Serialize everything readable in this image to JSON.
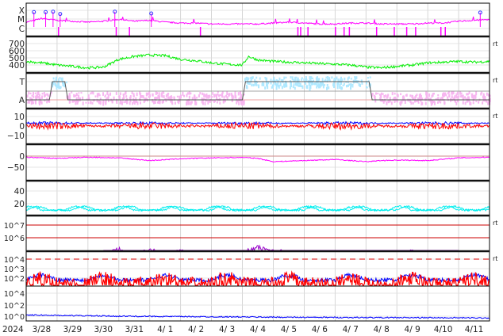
{
  "chart_data": {
    "type": "line",
    "title": "",
    "year_label": "2024",
    "x_tick_labels": [
      "3/28",
      "3/29",
      "3/30",
      "3/31",
      "4/ 1",
      "4/ 2",
      "4/ 3",
      "4/ 4",
      "4/ 5",
      "4/ 6",
      "4/ 7",
      "4/ 8",
      "4/ 9",
      "4/10",
      "4/11"
    ],
    "x_range_days": [
      0,
      15
    ],
    "realtime_marker": "rt",
    "panels": [
      {
        "name": "xray-flux",
        "tick_labels": [
          "X",
          "M",
          "C"
        ],
        "ylim_class": [
          1.5,
          4.5
        ],
        "series": [
          {
            "name": "xray",
            "color": "#ff00ff",
            "x": [
              0,
              0.5,
              1,
              1.5,
              2,
              2.5,
              3,
              3.5,
              4,
              4.5,
              5,
              5.5,
              6,
              6.5,
              7,
              7.5,
              8,
              8.5,
              9,
              9.5,
              10,
              10.5,
              11,
              11.5,
              12,
              12.5,
              13,
              13.5,
              14,
              14.5,
              15
            ],
            "y": [
              2.7,
              3.1,
              2.9,
              2.8,
              2.7,
              2.8,
              3.0,
              2.8,
              2.9,
              2.7,
              2.6,
              2.6,
              2.5,
              2.5,
              2.5,
              2.5,
              2.6,
              2.7,
              2.6,
              2.5,
              2.5,
              2.6,
              2.6,
              2.5,
              2.5,
              2.5,
              2.6,
              2.6,
              2.8,
              2.9,
              3.0
            ]
          }
        ],
        "flare_markers_days": [
          0.25,
          0.63,
          0.87,
          1.1,
          2.87,
          4.05,
          14.7
        ],
        "flare_marker_levels": [
          3.8,
          3.8,
          3.85,
          3.6,
          3.85,
          3.65,
          3.75
        ]
      },
      {
        "name": "solar-wind-speed",
        "tick_labels": [
          "700",
          "600",
          "500",
          "400"
        ],
        "ylim": [
          330,
          750
        ],
        "series": [
          {
            "name": "speed",
            "color": "#00ee00",
            "x": [
              0,
              0.5,
              1,
              1.5,
              2,
              2.5,
              3,
              3.5,
              4,
              4.5,
              5,
              5.5,
              6,
              6.5,
              7,
              7.2,
              7.5,
              8,
              8.5,
              9,
              9.5,
              10,
              10.5,
              11,
              11.5,
              12,
              12.5,
              13,
              13.5,
              14,
              14.5,
              15
            ],
            "y": [
              450,
              430,
              400,
              380,
              360,
              370,
              480,
              520,
              540,
              530,
              480,
              460,
              430,
              410,
              400,
              520,
              470,
              450,
              440,
              430,
              420,
              410,
              400,
              370,
              360,
              380,
              400,
              430,
              440,
              450,
              440,
              450
            ]
          }
        ]
      },
      {
        "name": "imf-direction",
        "tick_labels": [
          "T",
          "A"
        ],
        "series": [
          {
            "name": "sector",
            "color": "#555555",
            "x": [
              0,
              0.75,
              0.85,
              1.25,
              1.35,
              7.0,
              7.1,
              11.1,
              11.2,
              15
            ],
            "y": [
              0,
              0,
              1,
              1,
              0,
              0,
              1,
              1,
              0,
              0
            ]
          }
        ],
        "scatter_colors": [
          "#aee8ff",
          "#f7b6f0"
        ]
      },
      {
        "name": "imf-bz",
        "tick_labels": [
          "10",
          "0",
          "−10"
        ],
        "ylim": [
          -17,
          17
        ],
        "series": [
          {
            "name": "Bt",
            "color": "#0000ff",
            "base": 3
          },
          {
            "name": "Bz",
            "color": "#ff0000",
            "base": 0
          }
        ]
      },
      {
        "name": "dst-index",
        "tick_labels": [
          "0",
          "−50"
        ],
        "ylim": [
          -90,
          20
        ],
        "series": [
          {
            "name": "dst",
            "color": "#ff00ff",
            "x": [
              0,
              1,
              2,
              3,
              4,
              5,
              6,
              7,
              7.5,
              8,
              9,
              10,
              11,
              11.5,
              12,
              13,
              14,
              15
            ],
            "y": [
              -5,
              -10,
              -5,
              -8,
              -20,
              -12,
              -8,
              -6,
              -10,
              -25,
              -20,
              -15,
              -25,
              -20,
              -18,
              -20,
              -8,
              -5
            ]
          }
        ]
      },
      {
        "name": "kp-cyan",
        "tick_labels": [
          "40",
          "20"
        ],
        "ylim": [
          0,
          52
        ],
        "series": [
          {
            "name": "index",
            "color": "#00eeee",
            "base": 5
          }
        ]
      },
      {
        "name": "electron-flux",
        "tick_labels": [
          "10^7",
          "10^6"
        ],
        "ylim_log": [
          4.2,
          7.5
        ],
        "threshold_levels_log": [
          7,
          6
        ],
        "series": [
          {
            "name": "electrons",
            "color": "#9900cc",
            "x": [
              2.5,
              3,
              3.5,
              4,
              4.5,
              5,
              5.5,
              6,
              6.5,
              7,
              7.5,
              8,
              8.5,
              9,
              9.5,
              10,
              10.5,
              11,
              11.5,
              12,
              12.5,
              13,
              13.5,
              14
            ],
            "y": [
              4.5,
              5.1,
              4.6,
              5.0,
              4.7,
              4.9,
              4.6,
              4.7,
              4.5,
              4.8,
              5.2,
              5.0,
              4.8,
              4.7,
              4.6,
              4.8,
              4.5,
              4.6,
              4.5,
              4.6,
              4.9,
              4.8,
              4.7,
              4.5
            ]
          }
        ]
      },
      {
        "name": "proton-flux",
        "tick_labels": [
          "10^4",
          "10^3",
          "10^2"
        ],
        "ylim_log": [
          0.7,
          4.6
        ],
        "threshold_log": 4,
        "series": [
          {
            "name": "protons-high",
            "color": "#0000ff",
            "base_log": 1.8
          },
          {
            "name": "protons-low",
            "color": "#ff0000",
            "base_log": 1.3
          }
        ]
      },
      {
        "name": "low-flux",
        "tick_labels": [
          "10^4",
          "10^2",
          "10^0"
        ],
        "ylim_log": [
          -0.6,
          4.8
        ],
        "series": [
          {
            "name": "flux",
            "color": "#0000ff",
            "x": [
              0,
              3,
              6,
              9,
              12,
              15
            ],
            "y": [
              0.2,
              0,
              -0.1,
              -0.2,
              -0.25,
              -0.3
            ]
          }
        ]
      }
    ]
  }
}
